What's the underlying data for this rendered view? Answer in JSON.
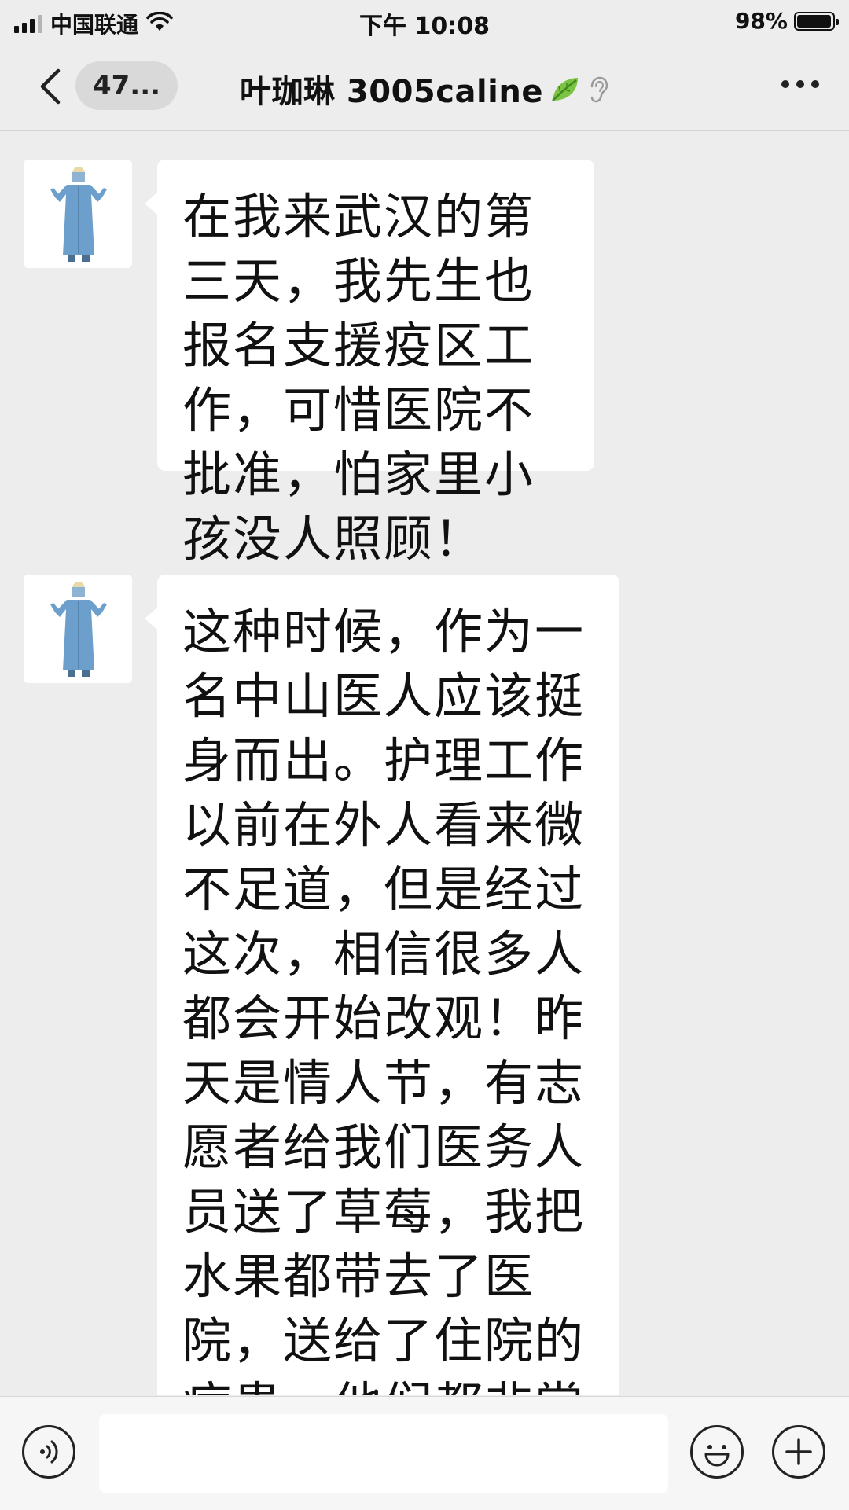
{
  "status_bar": {
    "carrier": "中国联通",
    "time": "下午 10:08",
    "battery": "98%",
    "battery_level": 0.98
  },
  "nav": {
    "unread_count": "47...",
    "title": "叶珈琳 3005caline",
    "icons": [
      "back-chevron-icon",
      "leaf-icon",
      "ear-icon",
      "more-dots-icon"
    ]
  },
  "messages": [
    {
      "sender": "叶珈琳 3005caline",
      "text": "在我来武汉的第三天，我先生也报名支援疫区工作，可惜医院不批准，怕家里小孩没人照顾！"
    },
    {
      "sender": "叶珈琳 3005caline",
      "text": "这种时候，作为一名中山医人应该挺身而出。护理工作以前在外人看来微不足道，但是经过这次，相信很多人都会开始改观！昨天是情人节，有志愿者给我们医务人员送了草莓，我把水果都带去了医院，送给了住院的病患。他们都非常的感动……"
    }
  ],
  "input_bar": {
    "placeholder": "",
    "icons": [
      "voice-icon",
      "emoji-icon",
      "plus-icon"
    ]
  },
  "colors": {
    "background": "#ededed",
    "bubble": "#ffffff",
    "text": "#111111",
    "unread_pill": "#d9d9d9"
  }
}
